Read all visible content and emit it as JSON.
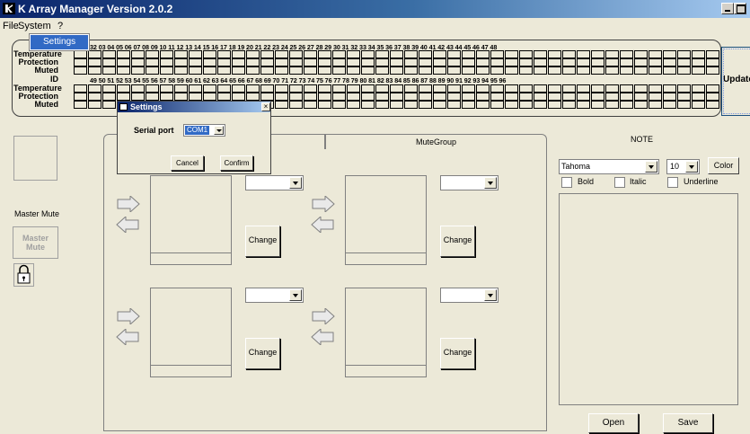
{
  "window": {
    "title": "K Array Manager Version 2.0.2"
  },
  "menu": {
    "file": "File",
    "system": "System",
    "help": "?",
    "dropdown_item": "Settings"
  },
  "status": {
    "labels": [
      "Temperature",
      "Protection",
      "Muted",
      "ID"
    ],
    "row1_ids": "32 03 04 05 06 07 08 09 10 11 12 13 14 15 16 17 18 19 20 21 22 23 24 25 26 27 28 29 30 31 32 33 34 35 36 37 38 39 40 41 42 43 44 45 46 47 48",
    "row2_ids": "49 50 51 52 53 54 55 56 57 58 59 60 61 62 63 64 65 66 67 68 69 70 71 72 73 74 75 76 77 78 79 80 81 82 83 84 85 86 87 88 89 90 91 92 93 94 95 96",
    "update_label": "Update"
  },
  "left": {
    "master_mute_label": "Master Mute",
    "master_mute_button": "Master Mute"
  },
  "tabs": [
    {
      "label": ""
    },
    {
      "label": "MuteGroup"
    }
  ],
  "groups": {
    "change_label": "Change"
  },
  "note": {
    "title": "NOTE",
    "font": "Tahoma",
    "size": "10",
    "color_label": "Color",
    "bold": "Bold",
    "italic": "Italic",
    "underline": "Underline",
    "open_label": "Open",
    "save_label": "Save"
  },
  "dialog": {
    "title": "Settings",
    "close": "×",
    "serial_label": "Serial port",
    "port_value": "COM1",
    "cancel": "Cancel",
    "confirm": "Confirm"
  }
}
